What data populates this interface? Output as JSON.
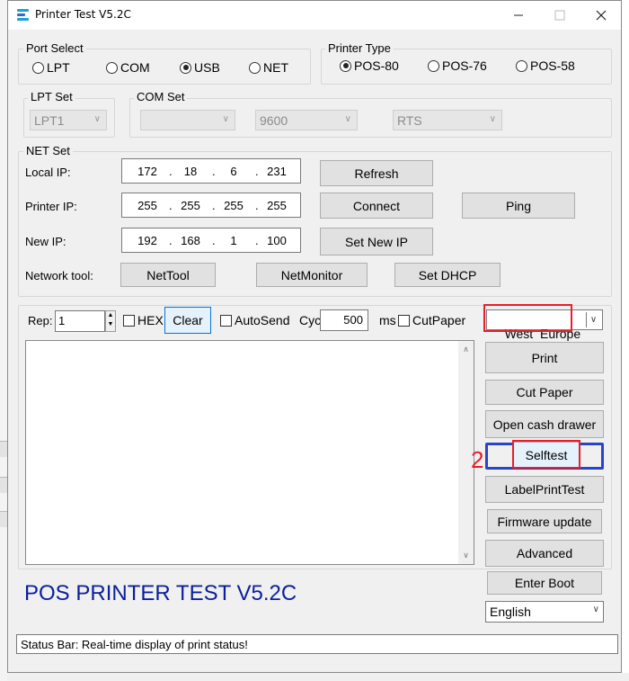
{
  "window": {
    "title": "Printer Test V5.2C"
  },
  "port_select": {
    "title": "Port Select",
    "options": [
      "LPT",
      "COM",
      "USB",
      "NET"
    ],
    "selected": "USB"
  },
  "printer_type": {
    "title": "Printer Type",
    "options": [
      "POS-80",
      "POS-76",
      "POS-58"
    ],
    "selected": "POS-80"
  },
  "lpt_set": {
    "title": "LPT Set",
    "value": "LPT1"
  },
  "com_set": {
    "title": "COM Set",
    "port": "",
    "baud": "9600",
    "flow": "RTS"
  },
  "net_set": {
    "title": "NET Set",
    "local_ip_label": "Local IP:",
    "local_ip": [
      "172",
      "18",
      "6",
      "231"
    ],
    "printer_ip_label": "Printer IP:",
    "printer_ip": [
      "255",
      "255",
      "255",
      "255"
    ],
    "new_ip_label": "New IP:",
    "new_ip": [
      "192",
      "168",
      "1",
      "100"
    ],
    "refresh": "Refresh",
    "connect": "Connect",
    "ping": "Ping",
    "set_new_ip": "Set New IP",
    "network_tool_label": "Network tool:",
    "nettool": "NetTool",
    "netmonitor": "NetMonitor",
    "setdhcp": "Set DHCP"
  },
  "controls": {
    "rep_label": "Rep:",
    "rep_value": "1",
    "hex_label": "HEX",
    "clear": "Clear",
    "autosend_label": "AutoSend",
    "cyc_label": "Cyc",
    "cyc_value": "500",
    "ms_label": "ms",
    "cutpaper_label": "CutPaper",
    "codepage": "West  Europe"
  },
  "actions": {
    "print": "Print",
    "cut_paper": "Cut Paper",
    "open_cash_drawer": "Open cash drawer",
    "selftest": "Selftest",
    "label_print_test": "LabelPrintTest",
    "firmware_update": "Firmware update",
    "advanced": "Advanced",
    "enter_boot": "Enter Boot",
    "language": "English"
  },
  "annotation": {
    "step": "2"
  },
  "app_title": "POS PRINTER TEST V5.2C",
  "status_bar": "Status Bar: Real-time display of print status!",
  "colors": {
    "app_title": "#0b1f9c",
    "highlight_red": "#e81e2a",
    "highlight_blue": "#2a44c8",
    "focus_border": "#0078d7"
  }
}
